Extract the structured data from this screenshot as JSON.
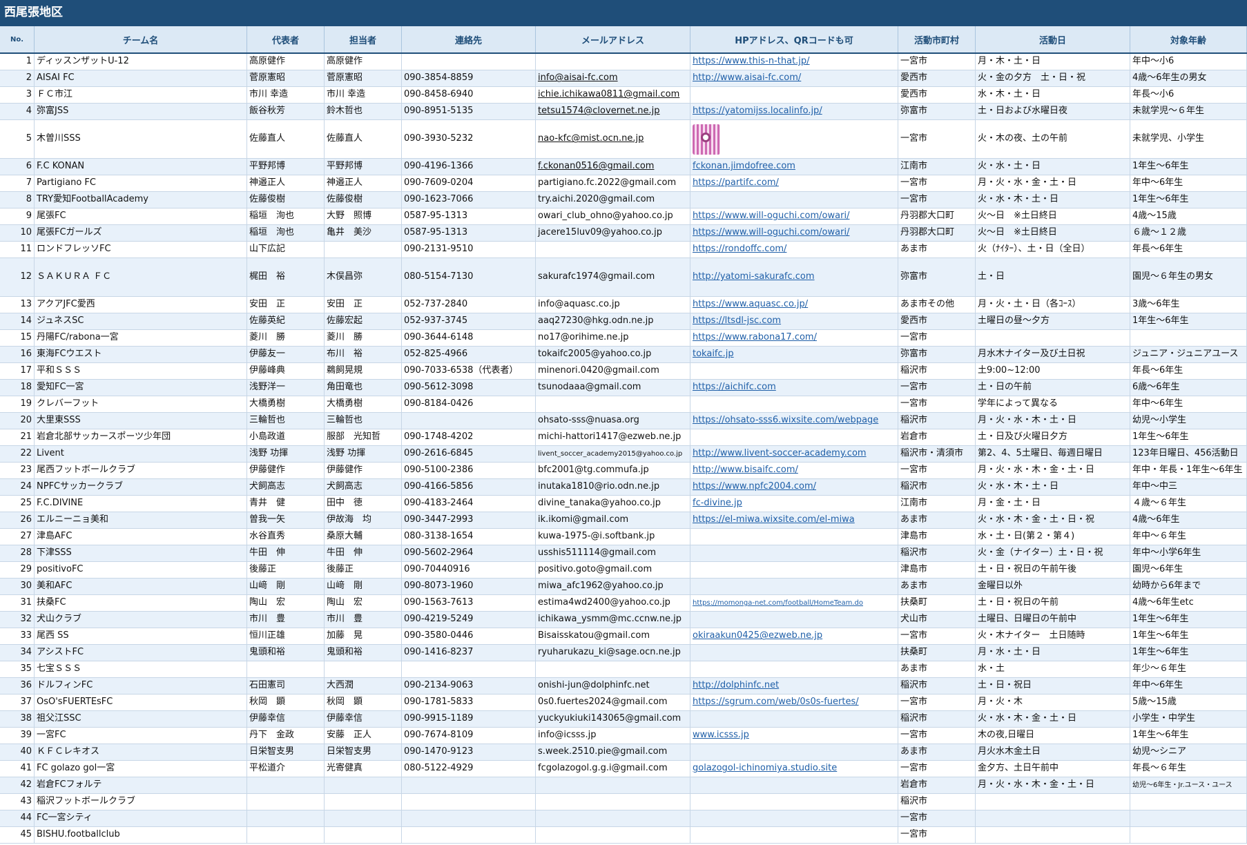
{
  "title": "西尾張地区",
  "headers": {
    "no": "No.",
    "team": "チーム名",
    "rep": "代表者",
    "person": "担当者",
    "phone": "連絡先",
    "email": "メールアドレス",
    "hp": "HPアドレス、QRコードも可",
    "city": "活動市町村",
    "days": "活動日",
    "age": "対象年齢"
  },
  "rows": [
    {
      "no": "1",
      "team": "ディッスンザットU-12",
      "rep": "高原健作",
      "person": "高原健作",
      "phone": "",
      "email": "",
      "hp": "https://www.this-n-that.jp/",
      "city": "一宮市",
      "days": "月・木・土・日",
      "age": "年中～小6"
    },
    {
      "no": "2",
      "team": "AISAI FC",
      "rep": "菅原憲昭",
      "person": "菅原憲昭",
      "phone": "090-3854-8859",
      "email": "info@aisai-fc.com",
      "hp": "http://www.aisai-fc.com/",
      "city": "愛西市",
      "days": "火・金の夕方　土・日・祝",
      "age": "4歳～6年生の男女"
    },
    {
      "no": "3",
      "team": "ＦＣ市江",
      "rep": "市川 幸造",
      "person": "市川 幸造",
      "phone": "090-8458-6940",
      "email": "ichie.ichikawa0811@gmail.com",
      "hp": "",
      "city": "愛西市",
      "days": "水・木・土・日",
      "age": "年長～小6"
    },
    {
      "no": "4",
      "team": "弥富JSS",
      "rep": "飯谷秋芳",
      "person": "鈴木哲也",
      "phone": "090-8951-5135",
      "email": "tetsu1574@clovernet.ne.jp",
      "hp": "https://yatomijss.localinfo.jp/",
      "city": "弥富市",
      "days": "土・日および水曜日夜",
      "age": "未就学児～６年生"
    },
    {
      "no": "5",
      "team": "木曽川SSS",
      "rep": "佐藤直人",
      "person": "佐藤直人",
      "phone": "090-3930-5232",
      "email": "nao-kfc@mist.ocn.ne.jp",
      "hp": "",
      "city": "一宮市",
      "days": "火・木の夜、土の午前",
      "age": "未就学児、小学生"
    },
    {
      "no": "6",
      "team": "F.C KONAN",
      "rep": "平野邦博",
      "person": "平野邦博",
      "phone": "090-4196-1366",
      "email": "f.ckonan0516@gmail.com",
      "hp": "fckonan.jimdofree.com",
      "city": "江南市",
      "days": "火・水・土・日",
      "age": "1年生～6年生"
    },
    {
      "no": "7",
      "team": "Partigiano FC",
      "rep": "神邉正人",
      "person": "神邉正人",
      "phone": "090-7609-0204",
      "email": "partigiano.fc.2022@gmail.com",
      "hp": "https://partifc.com/",
      "city": "一宮市",
      "days": "月・火・水・金・土・日",
      "age": "年中～6年生"
    },
    {
      "no": "8",
      "team": "TRY愛知FootballAcademy",
      "rep": "佐藤俊樹",
      "person": "佐藤俊樹",
      "phone": "090-1623-7066",
      "email": "try.aichi.2020@gmail.com",
      "hp": "",
      "city": "一宮市",
      "days": "火・水・木・土・日",
      "age": "1年生～6年生"
    },
    {
      "no": "9",
      "team": "尾張FC",
      "rep": "稲垣　洵也",
      "person": "大野　照博",
      "phone": "0587-95-1313",
      "email": "owari_club_ohno@yahoo.co.jp",
      "hp": "https://www.will-oguchi.com/owari/",
      "city": "丹羽郡大口町",
      "days": "火～日　※土日終日",
      "age": "4歳～15歳"
    },
    {
      "no": "10",
      "team": "尾張FCガールズ",
      "rep": "稲垣　洵也",
      "person": "亀井　美沙",
      "phone": "0587-95-1313",
      "email": "jacere15luv09@yahoo.co.jp",
      "hp": "https://www.will-oguchi.com/owari/",
      "city": "丹羽郡大口町",
      "days": "火～日　※土日終日",
      "age": "６歳～１２歳"
    },
    {
      "no": "11",
      "team": "ロンドフレッソFC",
      "rep": "山下広記",
      "person": "",
      "phone": "090-2131-9510",
      "email": "",
      "hp": "https://rondoffc.com/",
      "city": "あま市",
      "days": "火（ﾅｲﾀｰ）、土・日（全日）",
      "age": "年長～6年生"
    },
    {
      "no": "12",
      "team": "ＳＡＫＵＲＡ ＦＣ",
      "rep": "梶田　裕",
      "person": "木俣昌弥",
      "phone": "080-5154-7130",
      "email": "sakurafc1974@gmail.com",
      "hp": "http://yatomi-sakurafc.com",
      "city": "弥富市",
      "days": "土・日",
      "age": "園児～６年生の男女"
    },
    {
      "no": "13",
      "team": "アクアJFC愛西",
      "rep": "安田　正",
      "person": "安田　正",
      "phone": "052-737-2840",
      "email": "info@aquasc.co.jp",
      "hp": "https://www.aquasc.co.jp/",
      "city": "あま市その他",
      "days": "月・火・土・日（各ｺｰｽ）",
      "age": "3歳～6年生"
    },
    {
      "no": "14",
      "team": "ジュネスSC",
      "rep": "佐藤英紀",
      "person": "佐藤宏起",
      "phone": "052-937-3745",
      "email": "aaq27230@hkg.odn.ne.jp",
      "hp": "https://ltsdl-jsc.com",
      "city": "愛西市",
      "days": "土曜日の昼～夕方",
      "age": "1年生～6年生"
    },
    {
      "no": "15",
      "team": "丹陽FC/rabona一宮",
      "rep": "菱川　勝",
      "person": "菱川　勝",
      "phone": "090-3644-6148",
      "email": "no17@orihime.ne.jp",
      "hp": "https://www.rabona17.com/",
      "city": "一宮市",
      "days": "",
      "age": ""
    },
    {
      "no": "16",
      "team": "東海FCウエスト",
      "rep": "伊藤友一",
      "person": "布川　裕",
      "phone": "052-825-4966",
      "email": "tokaifc2005@yahoo.co.jp",
      "hp": "tokaifc.jp",
      "city": "弥富市",
      "days": "月水木ナイター及び土日祝",
      "age": "ジュニア・ジュニアユース"
    },
    {
      "no": "17",
      "team": "平和ＳＳＳ",
      "rep": "伊藤峰典",
      "person": "鵜飼晃規",
      "phone": "090-7033-6538（代表者）",
      "email": " minenori.0420@gmail.com",
      "hp": "",
      "city": "稲沢市",
      "days": "土9:00~12:00",
      "age": "年長～6年生"
    },
    {
      "no": "18",
      "team": "愛知FC一宮",
      "rep": "浅野洋一",
      "person": "角田竜也",
      "phone": "090-5612-3098",
      "email": "tsunodaaa@gmail.com",
      "hp": "https://aichifc.com",
      "city": "一宮市",
      "days": "土・日の午前",
      "age": "6歳～6年生"
    },
    {
      "no": "19",
      "team": "クレバーフット",
      "rep": "大橋勇樹",
      "person": "大橋勇樹",
      "phone": "090-8184-0426",
      "email": "",
      "hp": "",
      "city": "一宮市",
      "days": "学年によって異なる",
      "age": "年中～6年生"
    },
    {
      "no": "20",
      "team": "大里東SSS",
      "rep": "三輪哲也",
      "person": "三輪哲也",
      "phone": "",
      "email": "ohsato-sss@nuasa.org",
      "hp": "https://ohsato-sss6.wixsite.com/webpage",
      "city": "稲沢市",
      "days": "月・火・水・木・土・日",
      "age": "幼児～小学生"
    },
    {
      "no": "21",
      "team": "岩倉北部サッカースポーツ少年団",
      "rep": "小島政道",
      "person": "服部　光知哲",
      "phone": "090-1748-4202",
      "email": "michi-hattori1417@ezweb.ne.jp",
      "hp": "",
      "city": "岩倉市",
      "days": "土・日及び火曜日夕方",
      "age": "1年生～6年生"
    },
    {
      "no": "22",
      "team": "Livent",
      "rep": "浅野 功揮",
      "person": "浅野 功揮",
      "phone": "090-2616-6845",
      "email": "livent_soccer_academy2015@yahoo.co.jp",
      "hp": "http://www.livent-soccer-academy.com",
      "city": "稲沢市・清須市",
      "days": "第2、4、5土曜日、毎週日曜日",
      "age": "123年日曜日、456活動日"
    },
    {
      "no": "23",
      "team": "尾西フットボールクラブ",
      "rep": "伊藤健作",
      "person": "伊藤健作",
      "phone": "090-5100-2386",
      "email": "bfc2001@tg.commufa.jp",
      "hp": "http://www.bisaifc.com/",
      "city": "一宮市",
      "days": "月・火・水・木・金・土・日",
      "age": "年中・年長・1年生～6年生"
    },
    {
      "no": "24",
      "team": "NPFCサッカークラブ",
      "rep": "犬飼高志",
      "person": "犬飼高志",
      "phone": "090-4166-5856",
      "email": "inutaka1810@rio.odn.ne.jp",
      "hp": "https://www.npfc2004.com/",
      "city": "稲沢市",
      "days": "火・水・木・土・日",
      "age": "年中～中三"
    },
    {
      "no": "25",
      "team": "F.C.DIVINE",
      "rep": "青井　健",
      "person": "田中　徳",
      "phone": "090-4183-2464",
      "email": "divine_tanaka@yahoo.co.jp",
      "hp": "fc-divine.jp",
      "city": "江南市",
      "days": "月・金・土・日",
      "age": "４歳～６年生"
    },
    {
      "no": "26",
      "team": "エルニーニョ美和",
      "rep": "曽我一矢",
      "person": "伊故海　均",
      "phone": "090-3447-2993",
      "email": "ik.ikomi@gmail.com",
      "hp": "https://el-miwa.wixsite.com/el-miwa",
      "city": "あま市",
      "days": "火・水・木・金・土・日・祝",
      "age": "4歳～6年生"
    },
    {
      "no": "27",
      "team": "津島AFC",
      "rep": "水谷直秀",
      "person": "桑原大輔",
      "phone": "080-3138-1654",
      "email": "kuwa-1975-@i.softbank.jp",
      "hp": "",
      "city": "津島市",
      "days": "水・土・日(第２・第４)",
      "age": "年中～６年生"
    },
    {
      "no": "28",
      "team": "下津SSS",
      "rep": "牛田　伸",
      "person": "牛田　伸",
      "phone": "090-5602-2964",
      "email": "usshis511114@gmail.com",
      "hp": "",
      "city": "稲沢市",
      "days": "火・金（ナイター）土・日・祝",
      "age": "年中～小学6年生"
    },
    {
      "no": "29",
      "team": "positivoFC",
      "rep": "後藤正",
      "person": "後藤正",
      "phone": "090-70440916",
      "email": "positivo.goto@gmail.com",
      "hp": "",
      "city": "津島市",
      "days": "土・日・祝日の午前午後",
      "age": "園児～6年生"
    },
    {
      "no": "30",
      "team": "美和AFC",
      "rep": "山﨑　剛",
      "person": "山﨑　剛",
      "phone": "090-8073-1960",
      "email": "miwa_afc1962@yahoo.co.jp",
      "hp": "",
      "city": "あま市",
      "days": "金曜日以外",
      "age": "幼時から6年まで"
    },
    {
      "no": "31",
      "team": "扶桑FC",
      "rep": "陶山　宏",
      "person": "陶山　宏",
      "phone": "090-1563-7613",
      "email": "estima4wd2400@yahoo.co.jp",
      "hp": "https://momonga-net.com/football/HomeTeam.do",
      "city": "扶桑町",
      "days": "土・日・祝日の午前",
      "age": "4歳～6年生etc"
    },
    {
      "no": "32",
      "team": "犬山クラブ",
      "rep": "市川　豊",
      "person": "市川　豊",
      "phone": "090-4219-5249",
      "email": "ichikawa_ysmm@mc.ccnw.ne.jp",
      "hp": "",
      "city": "犬山市",
      "days": "土曜日、日曜日の午前中",
      "age": "1年生～6年生"
    },
    {
      "no": "33",
      "team": "尾西 SS",
      "rep": "恒川正雄",
      "person": "加藤　晃",
      "phone": "090-3580-0446",
      "email": "Bisaisskatou@gmail.com",
      "hp": "okiraakun0425@ezweb.ne.jp",
      "city": "一宮市",
      "days": "火・木ナイター　土日随時",
      "age": "1年生～6年生"
    },
    {
      "no": "34",
      "team": "アシストFC",
      "rep": "鬼頭和裕",
      "person": "鬼頭和裕",
      "phone": "090-1416-8237",
      "email": "ryuharukazu_ki@sage.ocn.ne.jp",
      "hp": "",
      "city": "扶桑町",
      "days": "月・水・土・日",
      "age": "1年生～6年生"
    },
    {
      "no": "35",
      "team": "七宝ＳＳＳ",
      "rep": "",
      "person": "",
      "phone": "",
      "email": "",
      "hp": "",
      "city": "あま市",
      "days": "水・土",
      "age": "年少～６年生"
    },
    {
      "no": "36",
      "team": "ドルフィンFC",
      "rep": "石田憲司",
      "person": "大西潤",
      "phone": "090-2134-9063",
      "email": "onishi-jun@dolphinfc.net",
      "hp": "http://dolphinfc.net",
      "city": "稲沢市",
      "days": "土・日・祝日",
      "age": "年中～6年生"
    },
    {
      "no": "37",
      "team": "OsO'sFUERTEsFC",
      "rep": "秋岡　顕",
      "person": "秋岡　顕",
      "phone": "090-1781-5833",
      "email": "0s0.fuertes2024@gmail.com",
      "hp": "https://sgrum.com/web/0s0s-fuertes/",
      "city": "一宮市",
      "days": "月・火・木",
      "age": "5歳～15歳"
    },
    {
      "no": "38",
      "team": "祖父江SSC",
      "rep": "伊藤幸信",
      "person": "伊藤幸信",
      "phone": "090-9915-1189",
      "email": "yuckyukiuki143065@gmail.com",
      "hp": "",
      "city": "稲沢市",
      "days": "火・水・木・金・土・日",
      "age": "小学生・中学生"
    },
    {
      "no": "39",
      "team": "一宮FC",
      "rep": "丹下　金政",
      "person": "安藤　正人",
      "phone": "090-7674-8109",
      "email": "info@icsss.jp",
      "hp": "www.icsss.jp",
      "city": "一宮市",
      "days": "木の夜,日曜日",
      "age": "1年生～6年生"
    },
    {
      "no": "40",
      "team": "ＫＦＣレキオス",
      "rep": "日栄智支男",
      "person": "日栄智支男",
      "phone": "090-1470-9123",
      "email": "s.week.2510.pie@gmail.com",
      "hp": "",
      "city": "あま市",
      "days": "月火水木金土日",
      "age": "幼児～シニア"
    },
    {
      "no": "41",
      "team": "FC golazo gol一宮",
      "rep": "平松道介",
      "person": "光寄健真",
      "phone": "080-5122-4929",
      "email": "fcgolazogol.g.g.i@gmail.com",
      "hp": "golazogol-ichinomiya.studio.site",
      "city": "一宮市",
      "days": "金夕方、土日午前中",
      "age": "年長～６年生"
    },
    {
      "no": "42",
      "team": "岩倉FCフォルテ",
      "rep": "",
      "person": "",
      "phone": "",
      "email": "",
      "hp": "",
      "city": "岩倉市",
      "days": "月・火・水・木・金・土・日",
      "age": "幼児～6年生・Jr.ユース・ユース"
    },
    {
      "no": "43",
      "team": "稲沢フットボールクラブ",
      "rep": "",
      "person": "",
      "phone": "",
      "email": "",
      "hp": "",
      "city": "稲沢市",
      "days": "",
      "age": ""
    },
    {
      "no": "44",
      "team": "FC一宮シティ",
      "rep": "",
      "person": "",
      "phone": "",
      "email": "",
      "hp": "",
      "city": "一宮市",
      "days": "",
      "age": ""
    },
    {
      "no": "45",
      "team": "BISHU.footballclub",
      "rep": "",
      "person": "",
      "phone": "",
      "email": "",
      "hp": "",
      "city": "一宮市",
      "days": "",
      "age": ""
    }
  ],
  "underlined_emails": [
    2,
    3,
    4,
    5,
    6
  ],
  "qr_rows": [
    5
  ],
  "tall_rows": [
    5,
    12
  ],
  "small_email_rows": [
    22
  ],
  "small_hp_rows": [
    31
  ],
  "small_age_rows": [
    42
  ],
  "colors": {
    "title_bg": "#1f4e79",
    "header_bg": "#dce9f5",
    "alt_row": "#e8f1fa",
    "link": "#1f5fa8"
  }
}
